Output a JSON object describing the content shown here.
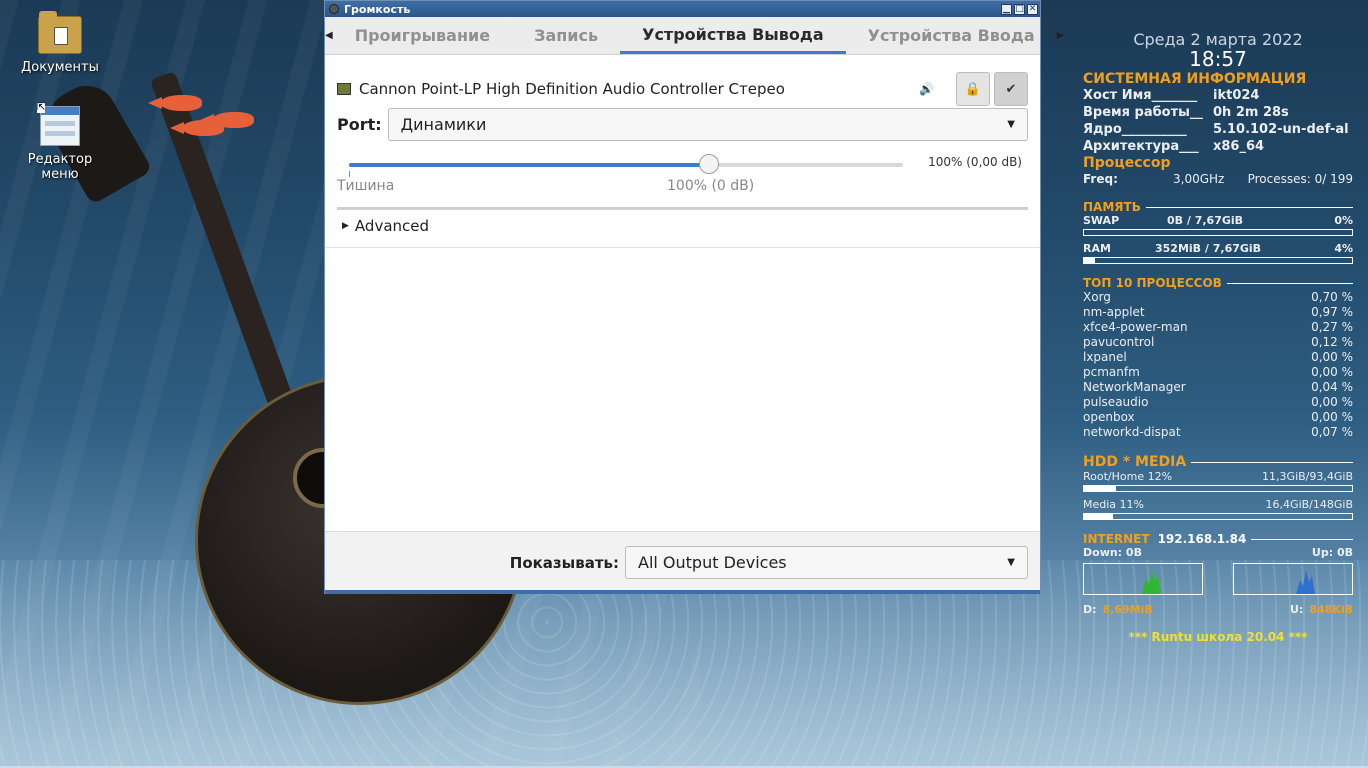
{
  "desktop": {
    "icons": [
      {
        "label": "Документы"
      },
      {
        "label": "Редактор меню"
      }
    ]
  },
  "window": {
    "title": "Громкость",
    "controls": {
      "minimize": "▁",
      "maximize": "□",
      "close": "✕"
    },
    "tabs": [
      {
        "label": "Проигрывание",
        "active": false
      },
      {
        "label": "Запись",
        "active": false
      },
      {
        "label": "Устройства Вывода",
        "active": true
      },
      {
        "label": "Устройства Ввода",
        "active": false
      }
    ],
    "device": {
      "name": "Cannon Point-LP High Definition Audio Controller Стерео",
      "port_label": "Port:",
      "port_value": "Динамики",
      "volume_fraction": 0.65,
      "volume_readout": "100% (0,00 dB)",
      "mark_silence": "Тишина",
      "mark_100": "100% (0 dB)",
      "advanced_label": "Advanced"
    },
    "footer": {
      "show_label": "Показывать:",
      "show_value": "All Output Devices"
    },
    "accent_color": "#3c7dd0"
  },
  "conky": {
    "date": "Среда  2 марта 2022",
    "time": "18:57",
    "sysinfo_title": "СИСТЕМНАЯ ИНФОРМАЦИЯ",
    "sysinfo": [
      {
        "k": "Хост Имя_______",
        "v": "ikt024"
      },
      {
        "k": "Время работы__",
        "v": "0h 2m 28s"
      },
      {
        "k": "Ядро__________",
        "v": "5.10.102-un-def-al"
      },
      {
        "k": "Архитектура___",
        "v": "x86_64"
      }
    ],
    "cpu_title": "Процессор",
    "freq_label": "Freq:",
    "freq_value": "3,00GHz",
    "processes": "Processes: 0/ 199",
    "mem_title": "ПАМЯТЬ",
    "swap": {
      "label": "SWAP",
      "value": "0B   / 7,67GiB",
      "pct": "0%",
      "fraction": 0.0
    },
    "ram": {
      "label": "RAM",
      "value": "352MiB / 7,67GiB",
      "pct": "4%",
      "fraction": 0.04
    },
    "top_title": "ТОП 10 ПРОЦЕССОВ",
    "top": [
      {
        "n": "Xorg",
        "v": "0,70 %"
      },
      {
        "n": "nm-applet",
        "v": "0,97 %"
      },
      {
        "n": "xfce4-power-man",
        "v": "0,27 %"
      },
      {
        "n": "pavucontrol",
        "v": "0,12 %"
      },
      {
        "n": "lxpanel",
        "v": "0,00 %"
      },
      {
        "n": "pcmanfm",
        "v": "0,00 %"
      },
      {
        "n": "NetworkManager",
        "v": "0,04 %"
      },
      {
        "n": "pulseaudio",
        "v": "0,00 %"
      },
      {
        "n": "openbox",
        "v": "0,00 %"
      },
      {
        "n": "networkd-dispat",
        "v": "0,07 %"
      }
    ],
    "hdd_title": "HDD * MEDIA",
    "root": {
      "label": "Root/Home 12%",
      "value": "11,3GiB/93,4GiB",
      "fraction": 0.12
    },
    "media": {
      "label": "Media   11%",
      "value": "16,4GiB/148GiB",
      "fraction": 0.11
    },
    "inet_title": "INTERNET",
    "ip": "192.168.1.84",
    "down_label": "Down: 0B",
    "up_label": "Up: 0B",
    "d_total_label": "D:",
    "d_total": "8,69MiB",
    "u_total_label": "U:",
    "u_total": "848KiB",
    "footer": "*** Runtu школа 20.04 ***"
  }
}
